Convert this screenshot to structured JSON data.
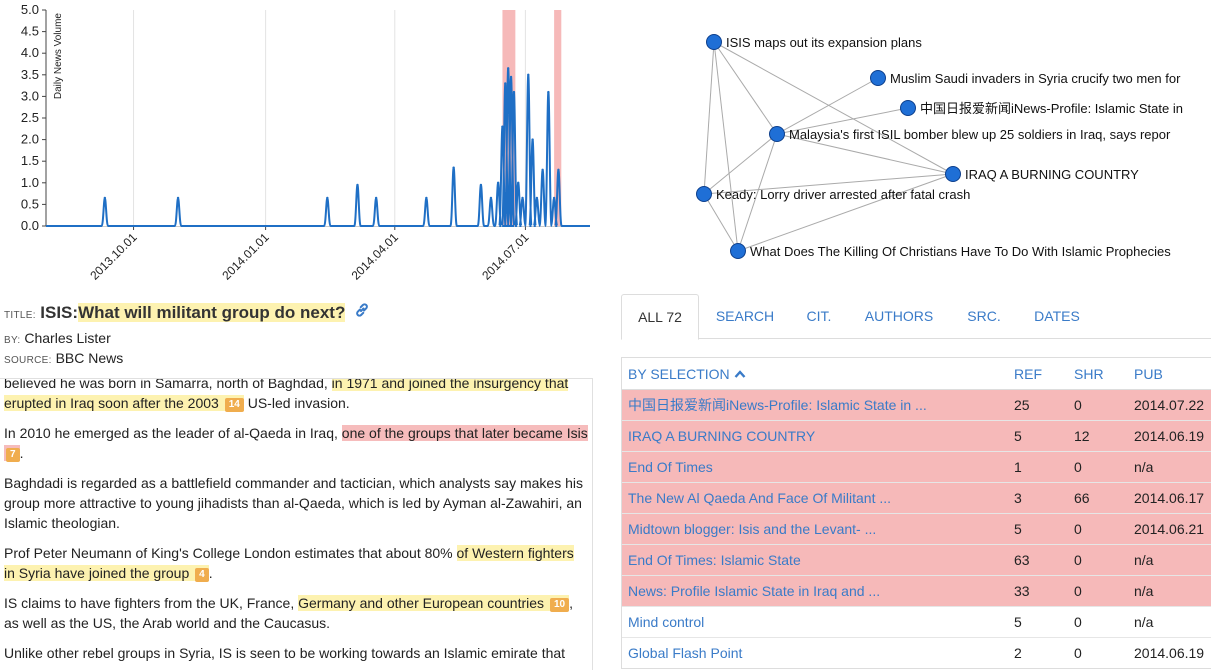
{
  "chart_data": {
    "type": "line",
    "ylabel": "Daily News Volume",
    "ylim": [
      0,
      5
    ],
    "yticks": [
      "0.0",
      "0.5",
      "1.0",
      "1.5",
      "2.0",
      "2.5",
      "3.0",
      "3.5",
      "4.0",
      "4.5",
      "5.0"
    ],
    "xticks": [
      {
        "label": "2013.10.01",
        "x": "2013-10-01"
      },
      {
        "label": "2014.01.01",
        "x": "2014-01-01"
      },
      {
        "label": "2014.04.01",
        "x": "2014-04-01"
      },
      {
        "label": "2014.07.01",
        "x": "2014-07-01"
      }
    ],
    "xrange": [
      "2013-08-01",
      "2014-08-15"
    ],
    "highlights": [
      {
        "start": "2014-06-15",
        "end": "2014-06-24"
      },
      {
        "start": "2014-07-21",
        "end": "2014-07-26"
      }
    ],
    "colors": {
      "line": "#1f6fc5",
      "highlight": "#f6b9b9"
    },
    "spikes": [
      {
        "x": "2013-09-11",
        "y": 0.65
      },
      {
        "x": "2013-11-01",
        "y": 0.65
      },
      {
        "x": "2014-02-13",
        "y": 0.65
      },
      {
        "x": "2014-03-06",
        "y": 0.95
      },
      {
        "x": "2014-03-19",
        "y": 0.65
      },
      {
        "x": "2014-04-23",
        "y": 0.65
      },
      {
        "x": "2014-05-12",
        "y": 1.35
      },
      {
        "x": "2014-05-31",
        "y": 0.95
      },
      {
        "x": "2014-06-07",
        "y": 0.65
      },
      {
        "x": "2014-06-12",
        "y": 1.0
      },
      {
        "x": "2014-06-15",
        "y": 2.3
      },
      {
        "x": "2014-06-17",
        "y": 3.3
      },
      {
        "x": "2014-06-19",
        "y": 3.65
      },
      {
        "x": "2014-06-21",
        "y": 3.45
      },
      {
        "x": "2014-06-23",
        "y": 3.1
      },
      {
        "x": "2014-06-26",
        "y": 1.0
      },
      {
        "x": "2014-06-29",
        "y": 0.65
      },
      {
        "x": "2014-07-03",
        "y": 3.5
      },
      {
        "x": "2014-07-06",
        "y": 2.0
      },
      {
        "x": "2014-07-09",
        "y": 0.65
      },
      {
        "x": "2014-07-13",
        "y": 1.3
      },
      {
        "x": "2014-07-17",
        "y": 3.1
      },
      {
        "x": "2014-07-21",
        "y": 0.65
      },
      {
        "x": "2014-07-24",
        "y": 1.3
      }
    ]
  },
  "network": {
    "nodes": [
      {
        "id": "n1",
        "label": "ISIS maps out its expansion plans"
      },
      {
        "id": "n2",
        "label": "Muslim Saudi invaders in Syria crucify two men for"
      },
      {
        "id": "n3",
        "label": "中国日报爱新闻iNews-Profile: Islamic State in"
      },
      {
        "id": "n4",
        "label": "Malaysia's first ISIL bomber blew up 25 soldiers in Iraq, says repor"
      },
      {
        "id": "n5",
        "label": "IRAQ A BURNING COUNTRY"
      },
      {
        "id": "n6",
        "label": "Keady: Lorry driver arrested after fatal crash"
      },
      {
        "id": "n7",
        "label": "What Does The Killing Of Christians Have To Do With Islamic Prophecies"
      }
    ],
    "edges": [
      [
        "n1",
        "n4"
      ],
      [
        "n1",
        "n5"
      ],
      [
        "n1",
        "n6"
      ],
      [
        "n1",
        "n7"
      ],
      [
        "n2",
        "n4"
      ],
      [
        "n3",
        "n4"
      ],
      [
        "n4",
        "n5"
      ],
      [
        "n4",
        "n6"
      ],
      [
        "n4",
        "n7"
      ],
      [
        "n5",
        "n6"
      ],
      [
        "n5",
        "n7"
      ],
      [
        "n6",
        "n7"
      ]
    ],
    "colors": {
      "node": "#1f6fd6",
      "edge": "#aaaaaa"
    }
  },
  "article": {
    "title_label": "TITLE:",
    "title_prefix": "ISIS:",
    "title_main": "What will militant group do next?",
    "by_label": "BY:",
    "author": "Charles Lister",
    "source_label": "SOURCE:",
    "source": "BBC News",
    "p1": {
      "plain": "believed he was born in Samarra, north of Baghdad, ",
      "hl": "in 1971 and joined the insurgency that erupted in Iraq soon after the 2003",
      "badge": "14",
      "tail": " US-led invasion."
    },
    "p2": {
      "plain": "In 2010 he emerged as the leader of al-Qaeda in Iraq, ",
      "hl": "one of the groups that later became Isis",
      "badge": "7",
      "tail": "."
    },
    "p3": "Baghdadi is regarded as a battlefield commander and tactician, which analysts say makes his group more attractive to young jihadists than al-Qaeda, which is led by Ayman al-Zawahiri, an Islamic theologian.",
    "p4": {
      "plain": "Prof Peter Neumann of King's College London estimates that about 80% ",
      "hl": "of Western fighters in Syria have joined the group",
      "badge": "4",
      "tail": "."
    },
    "p5": {
      "plain": "IS claims to have fighters from the UK, France, ",
      "hl": "Germany and other European countries",
      "badge": "10",
      "tail": ", as well as the US, the Arab world and the Caucasus."
    },
    "p6": "Unlike other rebel groups in Syria, IS is seen to be working towards an Islamic emirate that"
  },
  "tabs": [
    "ALL 72",
    "SEARCH",
    "CIT.",
    "AUTHORS",
    "SRC.",
    "DATES"
  ],
  "table": {
    "headers": {
      "title": "BY SELECTION",
      "ref": "REF",
      "shr": "SHR",
      "pub": "PUB"
    },
    "rows": [
      {
        "title": "中国日报爱新闻iNews-Profile: Islamic State in ...",
        "ref": "25",
        "shr": "0",
        "pub": "2014.07.22",
        "selected": true
      },
      {
        "title": "IRAQ A BURNING COUNTRY",
        "ref": "5",
        "shr": "12",
        "pub": "2014.06.19",
        "selected": true
      },
      {
        "title": "End Of Times",
        "ref": "1",
        "shr": "0",
        "pub": "n/a",
        "selected": true
      },
      {
        "title": "The New Al Qaeda And Face Of Militant ...",
        "ref": "3",
        "shr": "66",
        "pub": "2014.06.17",
        "selected": true
      },
      {
        "title": "Midtown blogger: Isis and the Levant- ...",
        "ref": "5",
        "shr": "0",
        "pub": "2014.06.21",
        "selected": true
      },
      {
        "title": "End Of Times: Islamic State",
        "ref": "63",
        "shr": "0",
        "pub": "n/a",
        "selected": true
      },
      {
        "title": "News: Profile Islamic State in Iraq and ...",
        "ref": "33",
        "shr": "0",
        "pub": "n/a",
        "selected": true
      },
      {
        "title": "Mind control",
        "ref": "5",
        "shr": "0",
        "pub": "n/a",
        "selected": false
      },
      {
        "title": "Global Flash Point",
        "ref": "2",
        "shr": "0",
        "pub": "2014.06.19",
        "selected": false
      }
    ]
  }
}
